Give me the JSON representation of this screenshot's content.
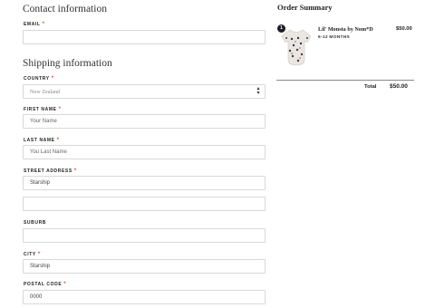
{
  "contact": {
    "heading": "Contact information",
    "email_label": "EMAIL",
    "email_value": "",
    "required_mark": "*"
  },
  "shipping": {
    "heading": "Shipping information",
    "country_label": "COUNTRY",
    "country_value": "New Zealand",
    "first_name_label": "FIRST NAME",
    "first_name_placeholder": "Your Name",
    "last_name_label": "LAST NAME",
    "last_name_placeholder": "You Last Name",
    "street_label": "STREET ADDRESS",
    "street_value": "Starship",
    "street2_value": "",
    "suburb_label": "SUBURB",
    "suburb_value": "",
    "city_label": "CITY",
    "city_value": "Starship",
    "postal_label": "POSTAL CODE",
    "postal_value": "0000"
  },
  "summary": {
    "title": "Order Summary",
    "item": {
      "quantity": "1",
      "name": "Lil' Monsta by Nom*D",
      "variant": "6-12 MONTHS",
      "price": "$50.00"
    },
    "total_label": "Total",
    "total_value": "$50.00"
  },
  "colors": {
    "required": "#d9534f",
    "badge": "#1e1e2a",
    "border": "#d8d8d8"
  }
}
